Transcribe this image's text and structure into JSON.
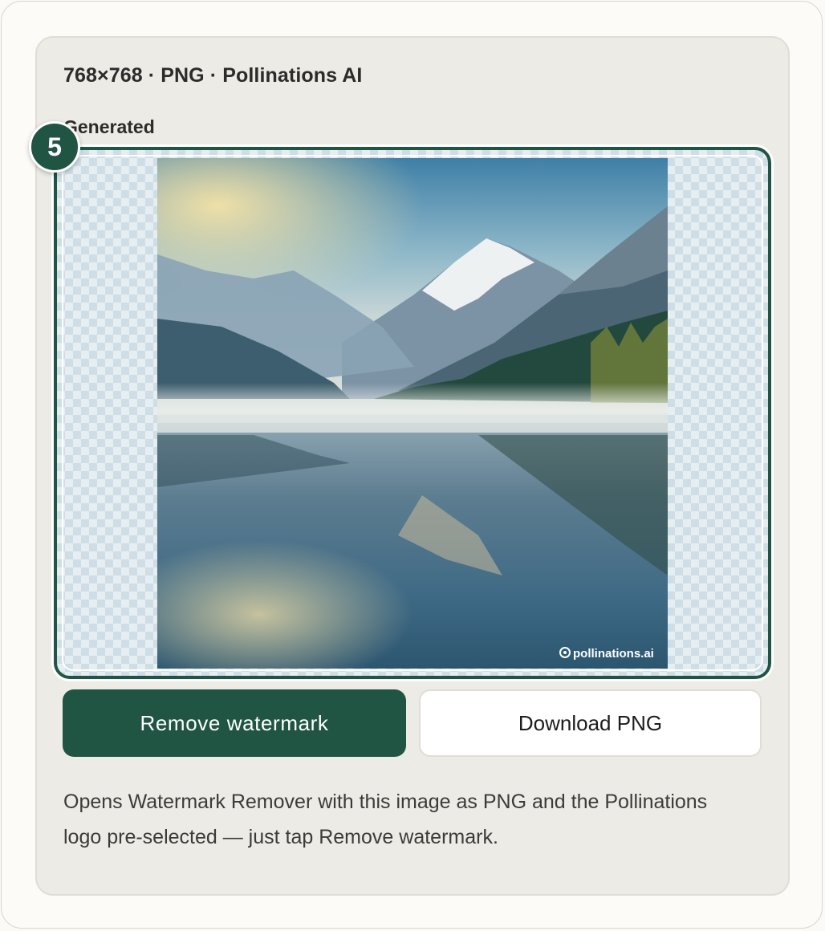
{
  "card": {
    "meta": "768×768 · PNG · Pollinations AI",
    "section_label": "Generated",
    "step_number": "5"
  },
  "image": {
    "watermark_text": "pollinations.ai"
  },
  "actions": {
    "remove_label": "Remove watermark",
    "download_label": "Download PNG"
  },
  "helper_text": "Opens Watermark Remover with this image as PNG and the Pollinations logo pre-selected — just tap Remove watermark.",
  "colors": {
    "accent": "#1f5542",
    "card_bg": "#ecebe5",
    "page_bg": "#fbfaf7"
  }
}
